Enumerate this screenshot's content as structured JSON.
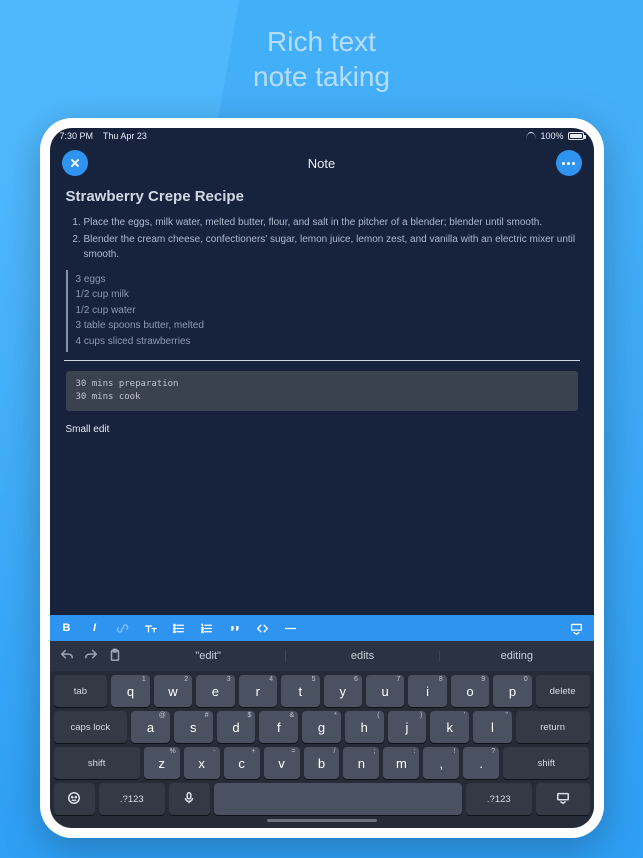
{
  "marketing": {
    "line1": "Rich text",
    "line2": "note taking"
  },
  "status": {
    "time": "7:30 PM",
    "date": "Thu Apr 23",
    "battery_pct": "100%"
  },
  "header": {
    "title": "Note"
  },
  "note": {
    "title": "Strawberry Crepe Recipe",
    "steps": [
      "Place the eggs, milk water, melted butter, flour, and salt in the pitcher of a blender; blender until smooth.",
      "Blender the cream cheese, confectioners' sugar, lemon juice, lemon zest, and vanilla with an electric mixer until smooth."
    ],
    "ingredients": [
      "3 eggs",
      "1/2 cup milk",
      "1/2 cup water",
      "3 table spoons butter, melted",
      "4 cups sliced strawberries"
    ],
    "code": "30 mins preparation\n30 mins cook",
    "trailing": "Small edit"
  },
  "format_bar": {
    "bold": "B",
    "italic": "I",
    "items": [
      "bold",
      "italic",
      "link",
      "text-size",
      "bullet-list",
      "numbered-list",
      "quote",
      "code",
      "hr"
    ],
    "right": "keyboard-hide"
  },
  "suggestions": {
    "s1": "\"edit\"",
    "s2": "edits",
    "s3": "editing"
  },
  "keyboard": {
    "row1": [
      "q",
      "w",
      "e",
      "r",
      "t",
      "y",
      "u",
      "i",
      "o",
      "p"
    ],
    "row1_hints": [
      "1",
      "2",
      "3",
      "4",
      "5",
      "6",
      "7",
      "8",
      "9",
      "0"
    ],
    "row2": [
      "a",
      "s",
      "d",
      "f",
      "g",
      "h",
      "j",
      "k",
      "l"
    ],
    "row2_hints": [
      "@",
      "#",
      "$",
      "&",
      "*",
      "(",
      ")",
      "'",
      "\""
    ],
    "row3": [
      "z",
      "x",
      "c",
      "v",
      "b",
      "n",
      "m",
      ",",
      "."
    ],
    "row3_hints": [
      "%",
      "-",
      "+",
      "=",
      "/",
      ";",
      ":",
      "!",
      "?"
    ],
    "fn": {
      "tab": "tab",
      "delete": "delete",
      "caps": "caps lock",
      "return": "return",
      "shiftL": "shift",
      "shiftR": "shift",
      "sym": ".?123"
    }
  }
}
